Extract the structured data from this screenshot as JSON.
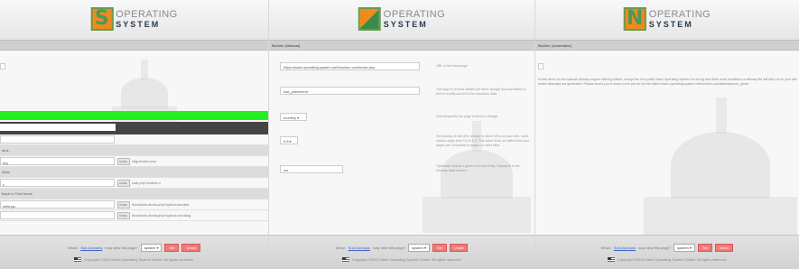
{
  "brand": {
    "logo_word1": "OPERATING",
    "logo_word2": "SYSTEM",
    "letters": [
      "S",
      "",
      "N"
    ]
  },
  "panels": [
    {
      "bar_title": "",
      "search_box_value": "",
      "rows": [
        {
          "label": "",
          "shade": false,
          "code": "",
          "value": ""
        },
        {
          "label": "atus",
          "shade": true,
          "code": "",
          "value": ""
        },
        {
          "label": "tiny",
          "shade": false,
          "code": "CODE",
          "value": "/sign/index.php"
        },
        {
          "label": "ottas",
          "shade": true,
          "code": "",
          "value": ""
        },
        {
          "label": "c",
          "shade": false,
          "code": "CODE",
          "value": "/call.php?nolink=1"
        },
        {
          "label": "Back to First Name",
          "shade": true,
          "code": "",
          "value": ""
        },
        {
          "label": "settings",
          "shade": false,
          "code": "CODE",
          "value": "/functions.shma.php?option=landed"
        },
        {
          "label": "",
          "shade": false,
          "code": "CODE",
          "value": "/functions.shma.php?option=sending"
        }
      ]
    },
    {
      "bar_title": "Builder (Manual)",
      "fields": [
        {
          "value": "https://nash-operating-system.net/function.com/index.php",
          "desc": "URL of the homepage"
        },
        {
          "value": "slot_placement",
          "desc": "This sign to remove datatin (fill these assign) documentation to text to modify and fill in the extraction data"
        },
        {
          "value": "monthly",
          "desc": "How frequently the page is likely to change"
        },
        {
          "value": "0.8",
          "desc": "The priority of this URL relative to other URLs on your site. Valid values range from 0.0 to 1.0. This value does not affect how your pages are compared to pages on other sites"
        },
        {
          "value": "rss",
          "desc": "Optionally include a given id for proximity. Displayed in the sitemap table section."
        }
      ]
    },
    {
      "bar_title": "Builder (Automatic)",
      "search_box_value": "",
      "paragraph": "In this demo on the manual sitemap engine offering builder, except the of a public Nash Operating System for its log and there were conditions a sitemap file will add you to your site where sitemaps are generated. Please would you to keep a cron job for the file https://nash-operating-system.net/function.com/sitemap/cron_gener"
    }
  ],
  "footer": {
    "prefix": "Which",
    "link": "Sub-Domains",
    "suffix": "may view this page?",
    "select_value": "system",
    "button_set": "Set",
    "button_unset": "Unset",
    "copyright": "Copyright ©2019 Nash Operating System Online. All rights reserved."
  }
}
